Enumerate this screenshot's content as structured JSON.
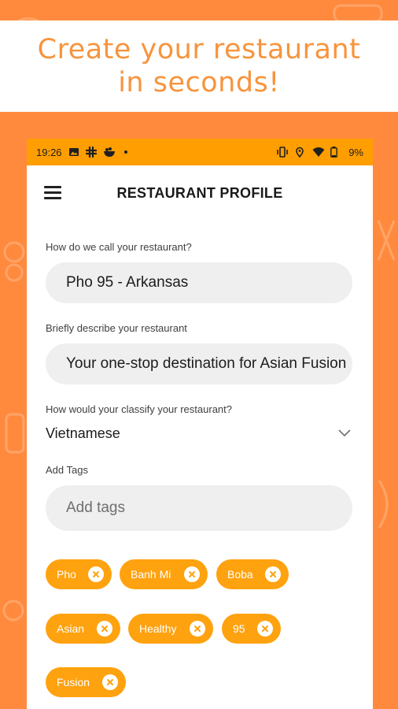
{
  "promo": {
    "line1": "Create your restaurant",
    "line2": "in seconds!"
  },
  "status_bar": {
    "time": "19:26",
    "battery": "9%",
    "left_icons": [
      "image-icon",
      "slack-icon",
      "food-bowl-icon",
      "dot-icon"
    ],
    "right_icons": [
      "vibrate-icon",
      "location-icon",
      "wifi-icon",
      "battery-icon"
    ]
  },
  "app_bar": {
    "title": "RESTAURANT PROFILE",
    "menu_icon": "hamburger-menu-icon"
  },
  "form": {
    "name": {
      "label": "How do we call your restaurant?",
      "value": "Pho 95 - Arkansas"
    },
    "description": {
      "label": "Briefly describe your restaurant",
      "value": "Your one-stop destination for Asian Fusion"
    },
    "classification": {
      "label": "How would your classify your restaurant?",
      "value": "Vietnamese"
    },
    "tags": {
      "label": "Add Tags",
      "placeholder": "Add tags",
      "items": [
        "Pho",
        "Banh Mi",
        "Boba",
        "Asian",
        "Healthy",
        "95",
        "Fusion"
      ]
    }
  },
  "colors": {
    "background": "#ff8a3d",
    "status_bar": "#ff9e00",
    "chip": "#ffa20f",
    "promo_text": "#f7943d"
  }
}
